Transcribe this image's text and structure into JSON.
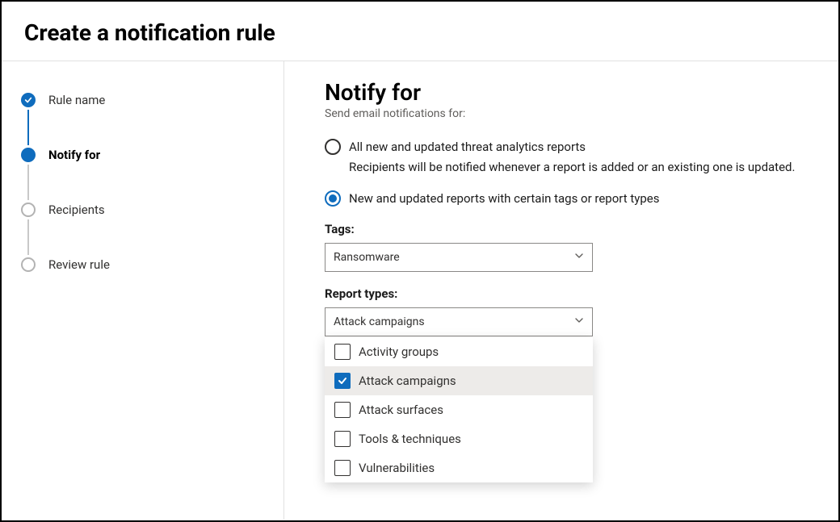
{
  "header": {
    "title": "Create a notification rule"
  },
  "steps": [
    {
      "label": "Rule name",
      "state": "done"
    },
    {
      "label": "Notify for",
      "state": "current"
    },
    {
      "label": "Recipients",
      "state": "pending"
    },
    {
      "label": "Review rule",
      "state": "pending"
    }
  ],
  "main": {
    "heading": "Notify for",
    "subtitle": "Send email notifications for:",
    "options": [
      {
        "label": "All new and updated threat analytics reports",
        "description": "Recipients will be notified whenever a report is added or an existing one is updated.",
        "selected": false
      },
      {
        "label": "New and updated reports with certain tags or report types",
        "selected": true
      }
    ],
    "tags": {
      "label": "Tags:",
      "value": "Ransomware"
    },
    "report_types": {
      "label": "Report types:",
      "value": "Attack campaigns",
      "options": [
        {
          "label": "Activity groups",
          "checked": false
        },
        {
          "label": "Attack campaigns",
          "checked": true
        },
        {
          "label": "Attack surfaces",
          "checked": false
        },
        {
          "label": "Tools & techniques",
          "checked": false
        },
        {
          "label": "Vulnerabilities",
          "checked": false
        }
      ]
    }
  },
  "colors": {
    "accent": "#0f6cbd"
  }
}
